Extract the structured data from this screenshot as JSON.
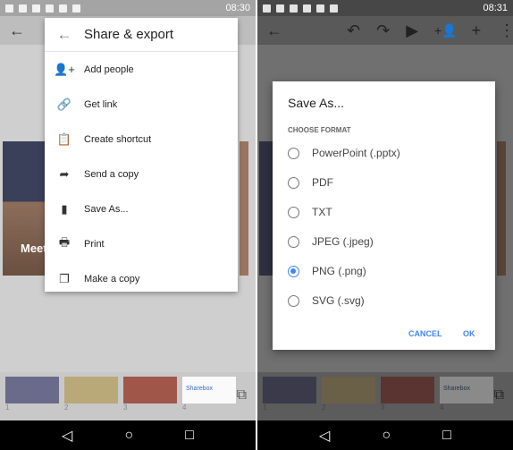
{
  "left": {
    "status": {
      "time": "08:30"
    },
    "slide_caption": "Meet",
    "menu": {
      "title": "Share & export",
      "items": [
        {
          "icon": "add-person-icon",
          "glyph": "👤+",
          "label": "Add people"
        },
        {
          "icon": "link-icon",
          "glyph": "🔗",
          "label": "Get link"
        },
        {
          "icon": "clipboard-icon",
          "glyph": "📋",
          "label": "Create shortcut"
        },
        {
          "icon": "share-arrow-icon",
          "glyph": "➦",
          "label": "Send a copy"
        },
        {
          "icon": "file-icon",
          "glyph": "▮",
          "label": "Save As..."
        },
        {
          "icon": "print-icon",
          "glyph": "🖶",
          "label": "Print"
        },
        {
          "icon": "copy-icon",
          "glyph": "❐",
          "label": "Make a copy"
        }
      ]
    },
    "film": [
      "1",
      "2",
      "3",
      "4"
    ],
    "thumb4_text": "Sharebox"
  },
  "right": {
    "status": {
      "time": "08:31"
    },
    "dialog": {
      "title": "Save As...",
      "subtitle": "CHOOSE FORMAT",
      "options": [
        {
          "label": "PowerPoint (.pptx)",
          "selected": false
        },
        {
          "label": "PDF",
          "selected": false
        },
        {
          "label": "TXT",
          "selected": false
        },
        {
          "label": "JPEG (.jpeg)",
          "selected": false
        },
        {
          "label": "PNG (.png)",
          "selected": true
        },
        {
          "label": "SVG (.svg)",
          "selected": false
        }
      ],
      "cancel": "CANCEL",
      "ok": "OK"
    },
    "film": [
      "1",
      "2",
      "3",
      "4"
    ],
    "thumb4_text": "Sharebox"
  },
  "colors": {
    "accent": "#4285f4"
  }
}
